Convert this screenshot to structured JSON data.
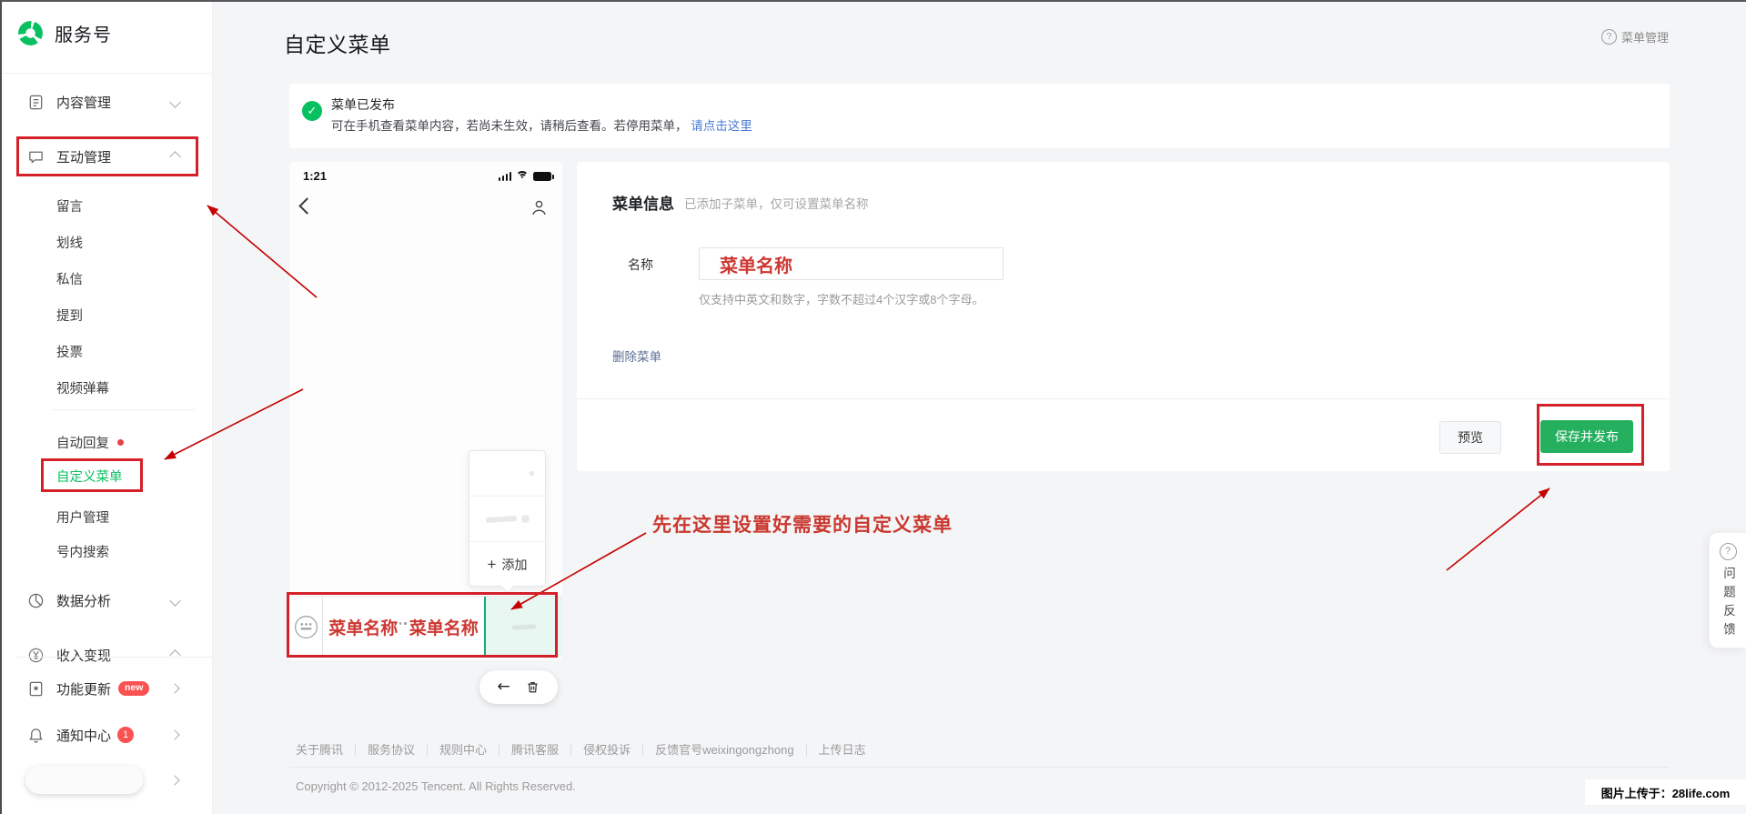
{
  "sidebar": {
    "logo": "服务号",
    "content_mgmt": "内容管理",
    "interact_mgmt": "互动管理",
    "interact_children": [
      "留言",
      "划线",
      "私信",
      "提到",
      "投票",
      "视频弹幕"
    ],
    "auto_reply": "自动回复",
    "custom_menu": "自定义菜单",
    "user_mgmt": "用户管理",
    "account_search": "号内搜索",
    "data_analysis": "数据分析",
    "monetization": "收入变现",
    "feature_update": "功能更新",
    "feature_badge": "new",
    "notification": "通知中心",
    "notification_badge": "1"
  },
  "header": {
    "title": "自定义菜单",
    "help": "菜单管理"
  },
  "banner": {
    "title": "菜单已发布",
    "text": "可在手机查看菜单内容，若尚未生效，请稍后查看。若停用菜单，",
    "link": "请点击这里"
  },
  "phone": {
    "time": "1:21",
    "menu_slots": [
      "菜单名称",
      "菜单名称"
    ],
    "popup_add": "添加"
  },
  "form": {
    "title": "菜单信息",
    "subtitle": "已添加子菜单，仅可设置菜单名称",
    "name_label": "名称",
    "name_value": "菜单名称",
    "hint": "仅支持中英文和数字，字数不超过4个汉字或8个字母。",
    "delete_link": "删除菜单",
    "preview": "预览",
    "save": "保存并发布"
  },
  "annotation": "先在这里设置好需要的自定义菜单",
  "footer": {
    "links": [
      "关于腾讯",
      "服务协议",
      "规则中心",
      "腾讯客服",
      "侵权投诉",
      "反馈官号weixingongzhong",
      "上传日志"
    ],
    "copyright": "Copyright © 2012-2025 Tencent. All Rights Reserved."
  },
  "feedback": "问题反馈",
  "watermark": "图片上传于：28life.com",
  "glyphs": {
    "plus": "+",
    "back": "←",
    "check": "✓",
    "question": "?"
  },
  "colors": {
    "brand_green": "#07c160",
    "annotation_red": "#c9382f",
    "link_blue": "#4b7bd5",
    "badge_red": "#fa5151",
    "box_red": "#d32029",
    "save_green": "#24b05e"
  }
}
